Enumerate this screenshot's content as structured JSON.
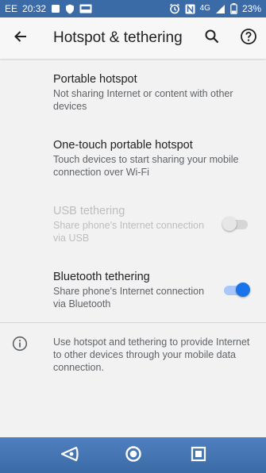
{
  "status_bar": {
    "carrier": "EE",
    "time": "20:32",
    "network": "4G",
    "battery": "23%",
    "colors": {
      "background": "#3b6ba6"
    }
  },
  "app_bar": {
    "title": "Hotspot & tethering",
    "back_icon": "arrow-left-icon",
    "search_icon": "search-icon",
    "help_icon": "help-icon"
  },
  "preferences": [
    {
      "title": "Portable hotspot",
      "summary": "Not sharing Internet or content with other devices",
      "enabled": true
    },
    {
      "title": "One-touch portable hotspot",
      "summary": "Touch devices to start sharing your mobile connection over Wi-Fi",
      "enabled": true
    },
    {
      "title": "USB tethering",
      "summary": "Share phone's Internet connection via USB",
      "enabled": false,
      "toggle": false
    },
    {
      "title": "Bluetooth tethering",
      "summary": "Share phone's Internet connection via Bluetooth",
      "enabled": true,
      "toggle": true
    }
  ],
  "info": {
    "icon": "info-icon",
    "text": "Use hotspot and tethering to provide Internet to other devices through your mobile data connection."
  },
  "nav_bar": {
    "back_icon": "nav-back-icon",
    "home_icon": "nav-home-icon",
    "recents_icon": "nav-recents-icon"
  },
  "colors": {
    "accent": "#1a73e8",
    "page_background": "#f2f2f2"
  }
}
